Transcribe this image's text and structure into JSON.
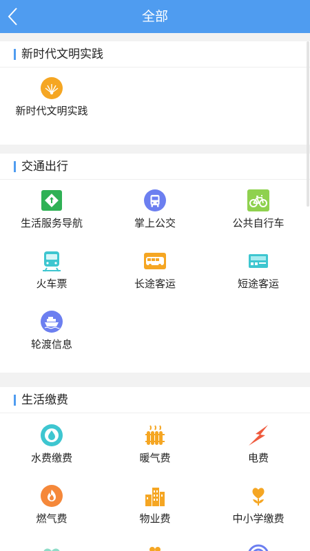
{
  "header": {
    "title": "全部"
  },
  "sections": [
    {
      "title": "新时代文明实践",
      "items": [
        {
          "label": "新时代文明实践",
          "icon": "sun-icon"
        }
      ]
    },
    {
      "title": "交通出行",
      "items": [
        {
          "label": "生活服务导航",
          "icon": "direction-sign-icon"
        },
        {
          "label": "掌上公交",
          "icon": "bus-icon"
        },
        {
          "label": "公共自行车",
          "icon": "bicycle-icon"
        },
        {
          "label": "火车票",
          "icon": "train-icon"
        },
        {
          "label": "长途客运",
          "icon": "coach-icon"
        },
        {
          "label": "短途客运",
          "icon": "ticket-icon"
        },
        {
          "label": "轮渡信息",
          "icon": "ship-icon"
        }
      ]
    },
    {
      "title": "生活缴费",
      "items": [
        {
          "label": "水费缴费",
          "icon": "water-drop-icon"
        },
        {
          "label": "暖气费",
          "icon": "radiator-icon"
        },
        {
          "label": "电费",
          "icon": "lightning-icon"
        },
        {
          "label": "燃气费",
          "icon": "flame-icon"
        },
        {
          "label": "物业费",
          "icon": "buildings-icon"
        },
        {
          "label": "中小学缴费",
          "icon": "flower-icon"
        }
      ]
    }
  ],
  "colors": {
    "header": "#4f9cf0",
    "accent_bar": "#4f9cf0",
    "background": "#f2f2f2"
  }
}
